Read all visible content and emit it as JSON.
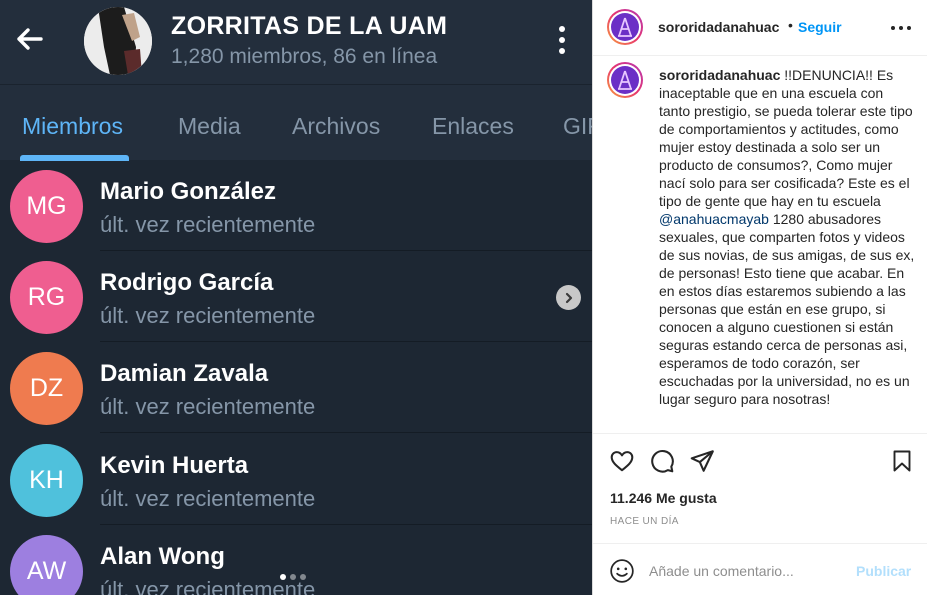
{
  "telegram": {
    "group_title": "ZORRITAS DE LA UAM",
    "group_subtitle": "1,280 miembros, 86 en línea",
    "icons": {
      "back": "arrow-left-icon",
      "menu": "more-vertical-icon",
      "chevron": "chevron-right-icon"
    },
    "tabs": [
      {
        "label": "Miembros",
        "active": true
      },
      {
        "label": "Media",
        "active": false
      },
      {
        "label": "Archivos",
        "active": false
      },
      {
        "label": "Enlaces",
        "active": false
      },
      {
        "label": "GIFs",
        "active": false
      }
    ],
    "members": [
      {
        "initials": "MG",
        "name": "Mario González",
        "status": "últ. vez recientemente",
        "color": "#ef5e90"
      },
      {
        "initials": "RG",
        "name": "Rodrigo García",
        "status": "últ. vez recientemente",
        "color": "#ef5e90"
      },
      {
        "initials": "DZ",
        "name": "Damian Zavala",
        "status": "últ. vez recientemente",
        "color": "#ef7b4f"
      },
      {
        "initials": "KH",
        "name": "Kevin Huerta",
        "status": "últ. vez recientemente",
        "color": "#4fc1dc"
      },
      {
        "initials": "AW",
        "name": "Alan Wong",
        "status": "últ. vez recientemente",
        "color": "#9d7fe0"
      }
    ],
    "colors": {
      "background": "#1d2733",
      "header": "#232e3c",
      "accent": "#5eb5f7",
      "muted": "#8596a8"
    }
  },
  "instagram": {
    "username": "sororidadanahuac",
    "separator": "•",
    "follow_label": "Seguir",
    "caption_user": "sororidadanahuac",
    "caption_before_mention": "!!DENUNCIA!! Es inaceptable que en una escuela con tanto prestigio, se pueda tolerar este tipo de comportamientos y actitudes, como mujer estoy destinada a solo ser un producto de consumos?, Como mujer nací solo para ser cosificada? Este es el tipo de gente que hay en tu escuela ",
    "mention": "@anahuacmayab",
    "caption_after_mention": " 1280 abusadores sexuales, que comparten fotos y videos de sus novias, de sus amigas, de sus ex, de personas! Esto tiene que acabar. En en estos días estaremos subiendo a las personas que están en ese grupo, si conocen a alguno cuestionen si están seguras estando cerca de personas asi, esperamos de todo corazón, ser escuchadas por la universidad, no es un lugar seguro para nosotras!",
    "likes": "11.246 Me gusta",
    "time": "HACE UN DÍA",
    "comment_placeholder": "Añade un comentario...",
    "publish_label": "Publicar",
    "icons": {
      "like": "heart-icon",
      "comment": "comment-icon",
      "share": "send-icon",
      "save": "bookmark-icon",
      "emoji": "emoji-icon",
      "more": "more-horizontal-icon"
    },
    "colors": {
      "link": "#0095f6",
      "mention": "#00376b",
      "publish_disabled": "#b2dffc"
    }
  }
}
